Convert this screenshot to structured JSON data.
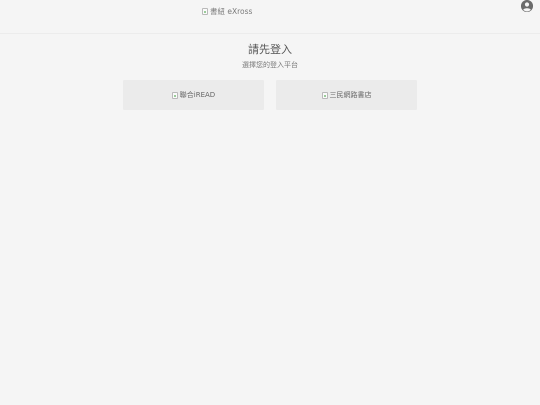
{
  "header": {
    "logo_alt": "書紐 eXross",
    "account_icon": "account-circle-icon"
  },
  "login": {
    "title": "請先登入",
    "subtitle": "選擇您的登入平台"
  },
  "platforms": [
    {
      "alt": "聯合iREAD"
    },
    {
      "alt": "三民網路書店"
    }
  ],
  "colors": {
    "background": "#f5f5f5",
    "card": "#ebebeb",
    "text": "#555555",
    "icon": "#6b6b6b"
  }
}
